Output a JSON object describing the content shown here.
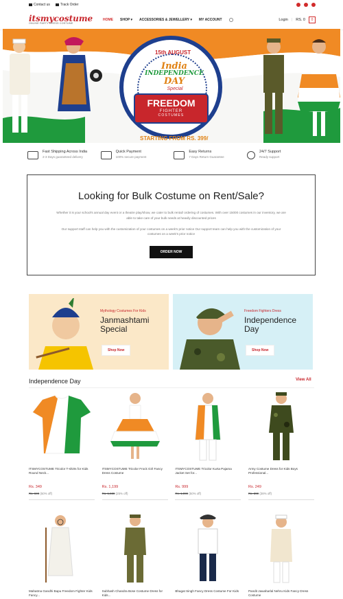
{
  "topbar": {
    "contact": "Contact us",
    "track": "Track Order"
  },
  "header": {
    "logo_text": "itsmycostume",
    "logo_tagline": "ONLINE PARTY DRESS COSTUME",
    "nav": [
      "HOME",
      "SHOP ▾",
      "ACCESSORIES & JEWELLERY ▾",
      "MY ACCOUNT"
    ],
    "login": "Login",
    "cart_total": "RS. 0",
    "cart_count": "0"
  },
  "banner": {
    "date": "15th AUGUST",
    "title_line1": "India",
    "title_line2": "INDEPENDENCE",
    "title_line3": "DAY",
    "special": "Special",
    "freedom": "FREEDOM",
    "fighter": "FIGHTER",
    "costumes": "COSTUMES",
    "starting": "STARTING FROM RS. 399/"
  },
  "features": [
    {
      "title": "Fast Shipping Across India",
      "sub": "2-3 Days guaranteed delivery"
    },
    {
      "title": "Quick Payment",
      "sub": "100% secure payment"
    },
    {
      "title": "Easy Returns",
      "sub": "7 Days Return Guarantee"
    },
    {
      "title": "24/7 Support",
      "sub": "Ready support"
    }
  ],
  "bulk": {
    "heading": "Looking for Bulk Costume on Rent/Sale?",
    "p1": "Whether it is your school's annual day event or a theatre play/show, we cater to bulk rental/ ordering of costumes. With over 15000 costumes in our inventory, we are able to take care of your bulk needs at heavily discounted prices",
    "p2": "Our support staff can help you with the customization of your costumes on a week's prior notice Our support team can help you with the customization of your costumes on a week's prior notice",
    "button": "ORDER NOW"
  },
  "promos": [
    {
      "caption": "Mythology Costumes For Kids",
      "title": "Janmashtami Special",
      "button": "Shop Now",
      "bg": "#fbe8c8"
    },
    {
      "caption": "Freedom Fighters Dress",
      "title": "Independence Day",
      "button": "Shop Now",
      "bg": "#d6f0f6"
    }
  ],
  "section": {
    "title": "Independence Day",
    "view_all": "View All"
  },
  "products_row1": [
    {
      "name": "ITSMYCOSTUME Tricolor T-shirts for Kids Round Neck...",
      "price": "Rs. 349",
      "old": "Rs. 699",
      "off": "(50% off)"
    },
    {
      "name": "ITSMYCOSTUME Tricolor Frock Girl Fancy Dress Costume",
      "price": "Rs. 1,199",
      "old": "Rs. 1,599",
      "off": "(25% off)"
    },
    {
      "name": "ITSMYCOSTUME Tricolor Kurta Pajama Jacket Set for...",
      "price": "Rs. 999",
      "old": "Rs. 1,999",
      "off": "(50% off)"
    },
    {
      "name": "Army Costume Dress for Kids Boys Professional...",
      "price": "Rs. 249",
      "old": "Rs. 399",
      "off": "(38% off)"
    }
  ],
  "products_row2": [
    {
      "name": "Mahatma Gandhi Bapu Freedom Fighter Kids Fancy..."
    },
    {
      "name": "Subhash Chandra Bose Costume Dress for Kids..."
    },
    {
      "name": "Bhagat Singh Fancy Dress Costume For Kids"
    },
    {
      "name": "Pandit Jawaharlal Nehru Kids Fancy Dress Costume"
    }
  ],
  "colors": {
    "accent": "#c8262c",
    "saffron": "#f08a24",
    "green": "#1f9a3d",
    "navy": "#1e3f8e"
  }
}
